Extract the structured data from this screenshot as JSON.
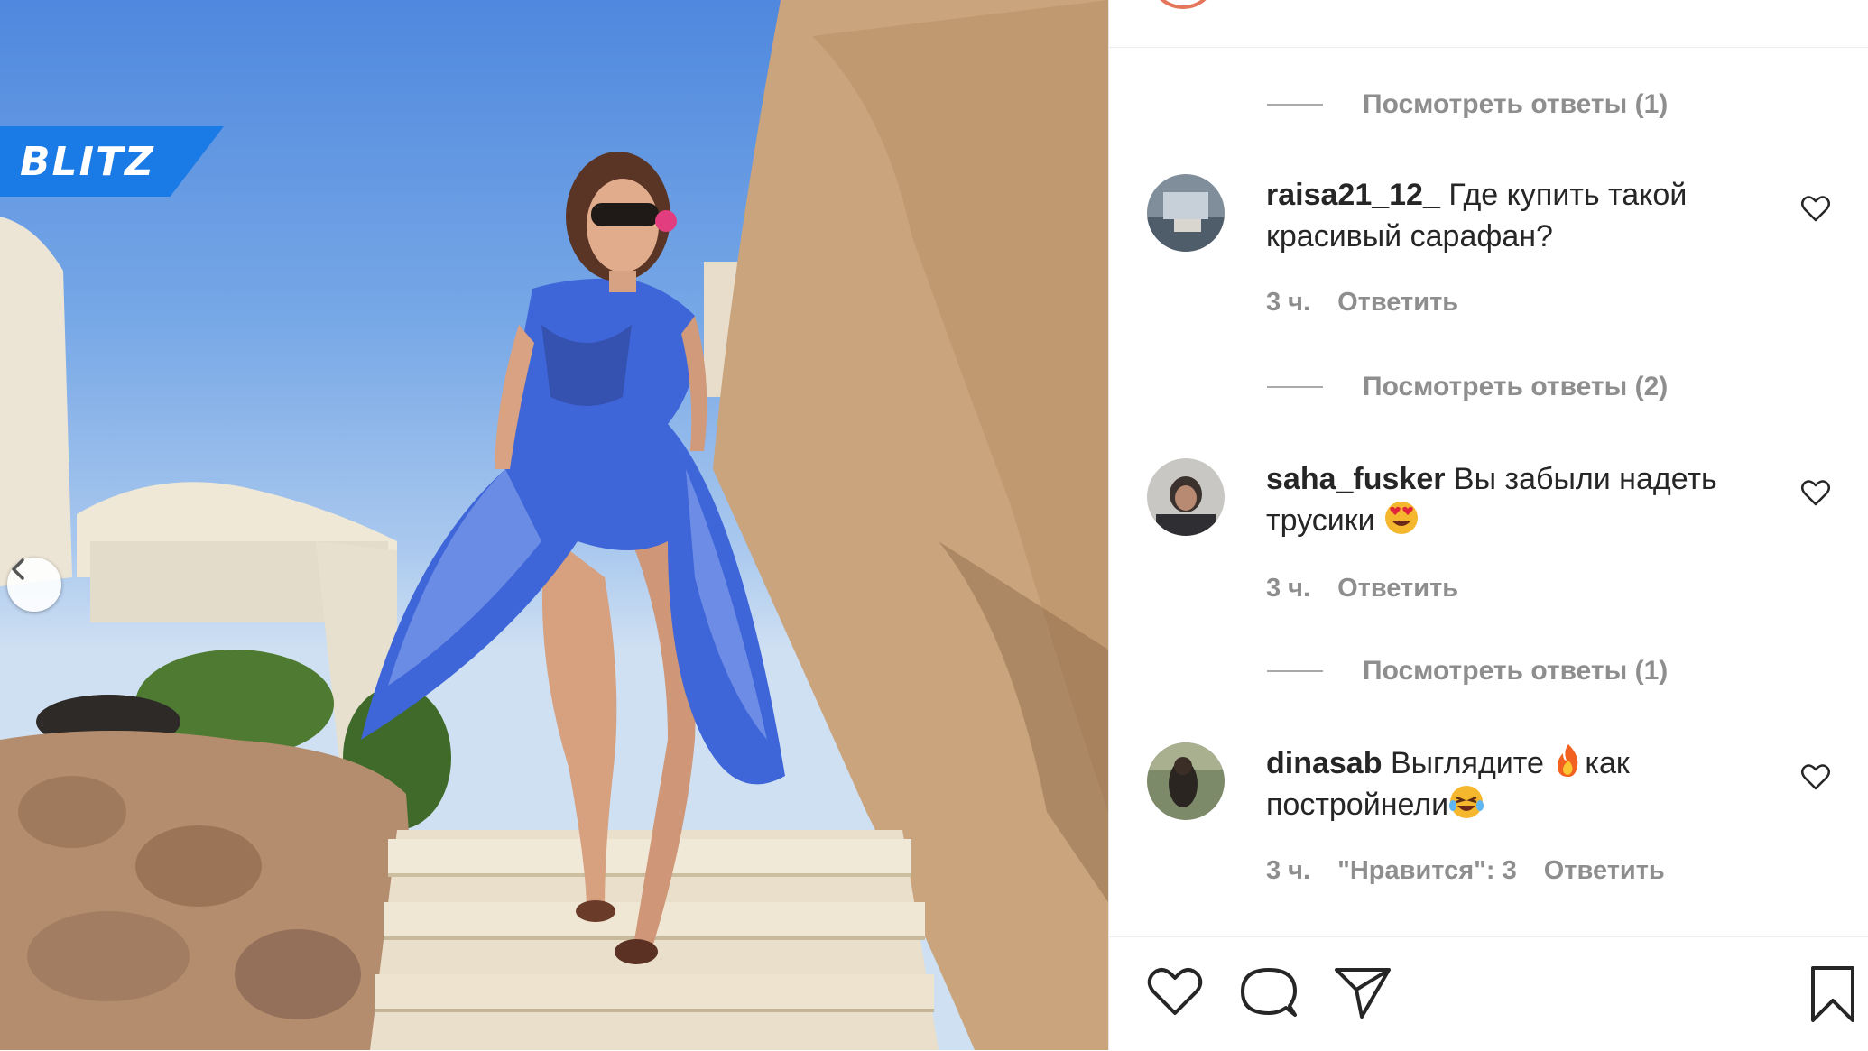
{
  "watermark": {
    "brand": "BLITZ",
    "color": "#1a7ae6"
  },
  "photo": {
    "controls": {
      "prev_icon": "chevron-left-icon"
    }
  },
  "comments_panel": {
    "top_text": "",
    "view_replies": [
      {
        "label": "Посмотреть ответы (1)"
      },
      {
        "label": "Посмотреть ответы (2)"
      },
      {
        "label": "Посмотреть ответы (1)"
      }
    ],
    "comments": [
      {
        "username": "raisa21_12_",
        "text": "Где купить такой красивый сарафан?",
        "emoji": "",
        "time": "3 ч.",
        "likes": "",
        "reply": "Ответить"
      },
      {
        "username": "saha_fusker",
        "text": "Вы забыли надеть трусики",
        "emoji": "heart-eyes",
        "time": "3 ч.",
        "likes": "",
        "reply": "Ответить"
      },
      {
        "username": "dinasab",
        "text_before": "Выглядите",
        "text_after": "как постройнели",
        "emoji_mid": "fire",
        "emoji_end": "laughing-tears",
        "time": "3 ч.",
        "likes": "\"Нравится\": 3",
        "reply": "Ответить"
      }
    ],
    "action_icons": [
      "heart-icon",
      "comment-icon",
      "share-icon",
      "bookmark-icon"
    ]
  },
  "colors": {
    "panel_bg": "#ffffff",
    "muted_text": "#8e8e8e",
    "text": "#262626"
  }
}
